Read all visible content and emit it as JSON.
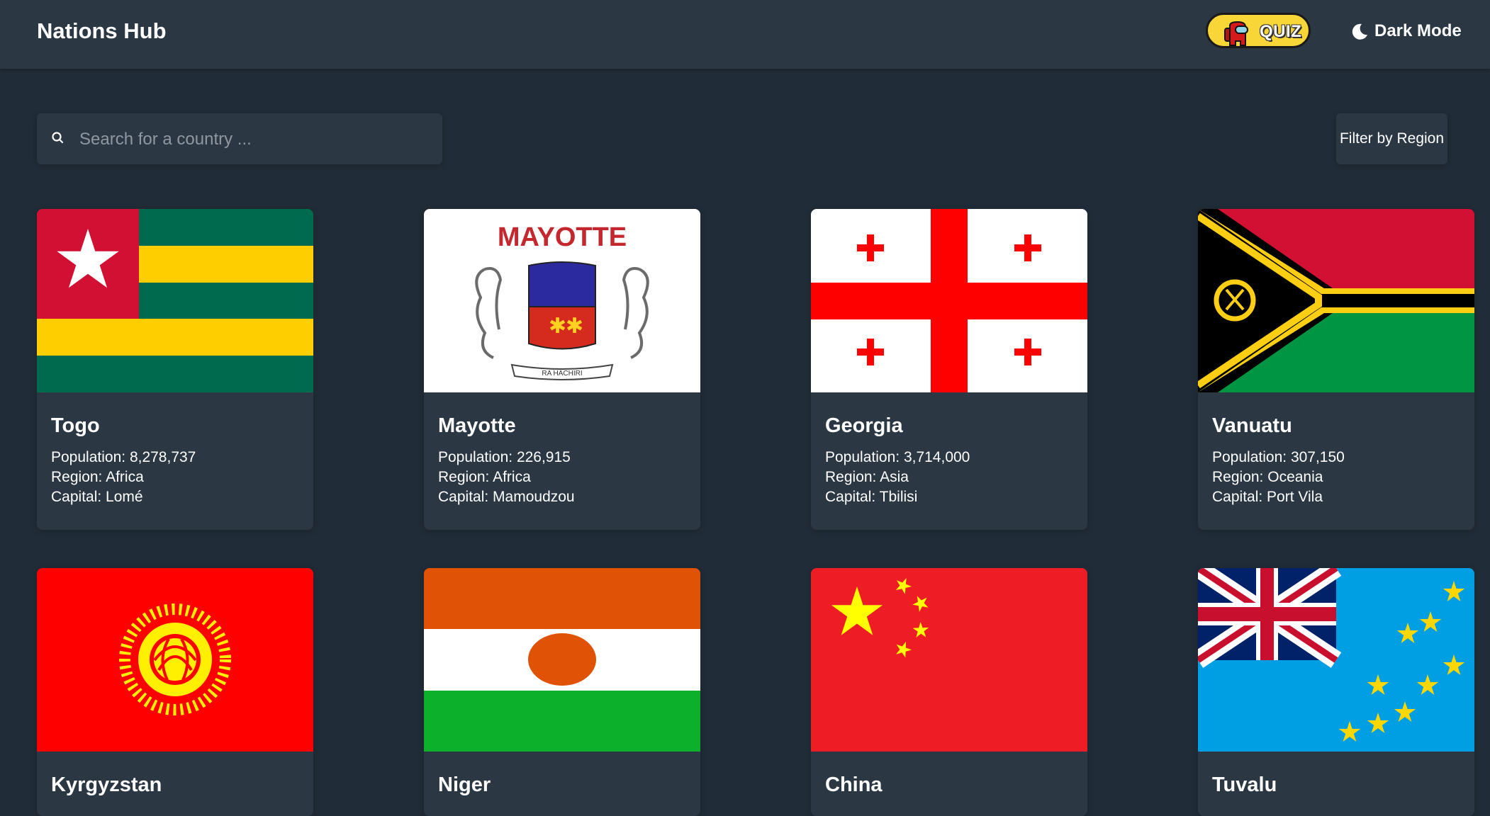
{
  "header": {
    "title": "Nations Hub",
    "quiz_label": "QUIZ",
    "dark_mode_label": "Dark Mode"
  },
  "search": {
    "placeholder": "Search for a country ...",
    "value": ""
  },
  "filter": {
    "label": "Filter by Region"
  },
  "labels": {
    "population": "Population:",
    "region": "Region:",
    "capital": "Capital:"
  },
  "mayotte_flag_text": {
    "title": "MAYOTTE",
    "motto": "RA HACHIRI"
  },
  "countries": [
    {
      "name": "Togo",
      "population": "8,278,737",
      "region": "Africa",
      "capital": "Lomé",
      "flag": "togo-flag"
    },
    {
      "name": "Mayotte",
      "population": "226,915",
      "region": "Africa",
      "capital": "Mamoudzou",
      "flag": "mayotte-flag"
    },
    {
      "name": "Georgia",
      "population": "3,714,000",
      "region": "Asia",
      "capital": "Tbilisi",
      "flag": "georgia-flag"
    },
    {
      "name": "Vanuatu",
      "population": "307,150",
      "region": "Oceania",
      "capital": "Port Vila",
      "flag": "vanuatu-flag"
    },
    {
      "name": "Kyrgyzstan",
      "flag": "kyrgyzstan-flag"
    },
    {
      "name": "Niger",
      "flag": "niger-flag"
    },
    {
      "name": "China",
      "flag": "china-flag"
    },
    {
      "name": "Tuvalu",
      "flag": "tuvalu-flag"
    }
  ],
  "colors": {
    "background": "#202c37",
    "surface": "#2b3743",
    "text": "#ffffff",
    "placeholder": "#8f98a0",
    "quiz_button": "#f8d637"
  },
  "icons": {
    "search": "search-icon",
    "dark_mode": "moon-icon",
    "quiz": "crewmate-icon"
  }
}
